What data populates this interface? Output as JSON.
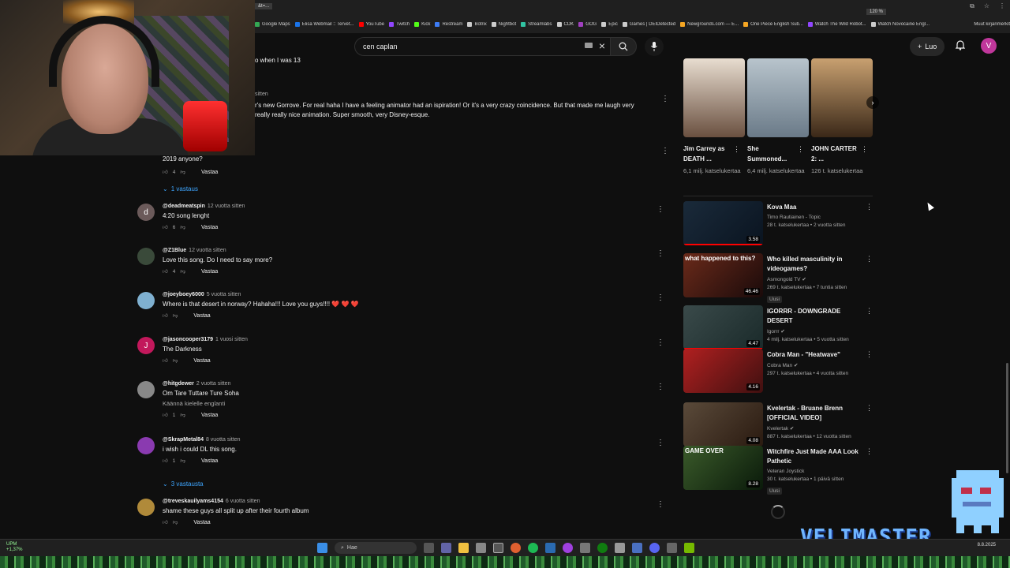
{
  "browser": {
    "url_fragment": "&t=...",
    "zoom": "120 %",
    "bookmarks": [
      {
        "label": "Google Maps",
        "color": "#34a853"
      },
      {
        "label": "Elisa Webmail :: Tervet...",
        "color": "#1a73e8"
      },
      {
        "label": "YouTube",
        "color": "#ff0000"
      },
      {
        "label": "Twitch",
        "color": "#9146ff"
      },
      {
        "label": "Kick",
        "color": "#53fc18"
      },
      {
        "label": "Restream",
        "color": "#3d7cf5"
      },
      {
        "label": "Botrix",
        "color": "#cccccc"
      },
      {
        "label": "Nightbot",
        "color": "#cccccc"
      },
      {
        "label": "Streamlabs",
        "color": "#31c3a2"
      },
      {
        "label": "CDK",
        "color": "#cccccc"
      },
      {
        "label": "GOG",
        "color": "#a040c0"
      },
      {
        "label": "Epic",
        "color": "#cccccc"
      },
      {
        "label": "Games | DEIDetected",
        "color": "#cccccc"
      },
      {
        "label": "Newgrounds.com — E...",
        "color": "#f5a623"
      },
      {
        "label": "One Piece English Sub...",
        "color": "#f5a623"
      },
      {
        "label": "Watch The Wild Robot...",
        "color": "#9146ff"
      },
      {
        "label": "Watch Novocaine Engl...",
        "color": "#cccccc"
      }
    ],
    "other_bookmarks": "Muut kirjanmerkit"
  },
  "yt_header": {
    "search_value": "cen caplan",
    "create_label": "Luo",
    "user_initial": "V"
  },
  "comments": {
    "partial_top": "o when I was 13",
    "partial_time": "sitten",
    "partial_text_line1": "r's new Gorrove. For real haha I have a feeling animator had an ispiration! Or it's a very crazy coincidence. But that made me laugh very",
    "partial_text_line2": "really really nice animation. Super smooth, very Disney-esque.",
    "partial_comment2_text": "2019 anyone?",
    "partial_comment2_likes": "4",
    "reply_label": "Vastaa",
    "one_reply": "1 vastaus",
    "items": [
      {
        "author": "@deadmeatspin",
        "time": "12 vuotta sitten",
        "text": "4:20 song lenght",
        "likes": "6",
        "avatar_letter": "d",
        "avatar_color": "#6b5a5a"
      },
      {
        "author": "@Z1Blue",
        "time": "12 vuotta sitten",
        "text": "Love this song. Do I need to say more?",
        "likes": "4",
        "avatar_letter": "",
        "avatar_color": "#3a4a3a"
      },
      {
        "author": "@joeyboey6000",
        "time": "5 vuotta sitten",
        "text": "Where is that desert in norway? Hahaha!!! Love you guys!!!! ❤️ ❤️ ❤️",
        "likes": "",
        "avatar_letter": "",
        "avatar_color": "#7fb0d0"
      },
      {
        "author": "@jasoncooper3179",
        "time": "1 vuosi sitten",
        "text": "The Darkness",
        "likes": "",
        "avatar_letter": "J",
        "avatar_color": "#c2185b"
      },
      {
        "author": "@hitgdewer",
        "time": "2 vuotta sitten",
        "text": "Om Tare Tuttare Ture Soha",
        "translate": "Käännä kielelle englanti",
        "likes": "1",
        "avatar_letter": "",
        "avatar_color": "#888888"
      },
      {
        "author": "@SkrapMetal84",
        "time": "8 vuotta sitten",
        "text": "i wish i could DL this song.",
        "likes": "1",
        "avatar_letter": "",
        "avatar_color": "#8a3ab0"
      },
      {
        "author": "@treveskauilyams4154",
        "time": "6 vuotta sitten",
        "text": "shame these guys all split up after their fourth album",
        "likes": "",
        "avatar_letter": "",
        "avatar_color": "#b08a3a"
      }
    ],
    "three_replies": "3 vastausta"
  },
  "shorts": [
    {
      "title": "Jim Carrey as DEATH ...",
      "views": "6,1 milj. katselukertaa",
      "color1": "#e8ddd0",
      "color2": "#6a5040"
    },
    {
      "title": "She Summoned...",
      "views": "6,4 milj. katselukertaa",
      "color1": "#b8c4cc",
      "color2": "#6a7a88"
    },
    {
      "title": "JOHN CARTER 2: ...",
      "views": "126 t. katselukertaa",
      "color1": "#c8a070",
      "color2": "#3a2818"
    }
  ],
  "videos": [
    {
      "title": "Kova Maa",
      "channel": "Timo Rautiainen - Topic",
      "meta": "28 t. katselukertaa • 2 vuotta sitten",
      "duration": "3.58",
      "progress": 100,
      "new": "",
      "thumb1": "#1a2a3a",
      "thumb2": "#0a1420",
      "verified": false
    },
    {
      "title": "Who killed masculinity in videogames?",
      "channel": "Asmongold TV",
      "meta": "269 t. katselukertaa • 7 tuntia sitten",
      "duration": "46.46",
      "progress": 0,
      "new": "Uusi",
      "thumb1": "#6a2a1a",
      "thumb2": "#1a0a0a",
      "thumb_text": "what happened to this?",
      "verified": true
    },
    {
      "title": "IGORRR - DOWNGRADE DESERT",
      "channel": "Igorrr",
      "meta": "4 milj. katselukertaa • 5 vuotta sitten",
      "duration": "4.47",
      "progress": 100,
      "new": "",
      "thumb1": "#3a4a4a",
      "thumb2": "#1a2a2a",
      "verified": true
    },
    {
      "title": "Cobra Man - \"Heatwave\"",
      "channel": "Cobra Man",
      "meta": "297 t. katselukertaa • 4 vuotta sitten",
      "duration": "4.16",
      "progress": 0,
      "new": "",
      "thumb1": "#b02020",
      "thumb2": "#401010",
      "verified": true
    },
    {
      "title": "Kvelertak - Bruane Brenn [OFFICIAL VIDEO]",
      "channel": "Kvelertak",
      "meta": "887 t. katselukertaa • 12 vuotta sitten",
      "duration": "4.08",
      "progress": 0,
      "new": "",
      "thumb1": "#5a4a3a",
      "thumb2": "#2a1a10",
      "verified": true
    },
    {
      "title": "Witchfire Just Made AAA Look Pathetic",
      "channel": "Veteran Joystick",
      "meta": "30 t. katselukertaa • 1 päivä sitten",
      "duration": "8.28",
      "progress": 0,
      "new": "Uusi",
      "thumb1": "#3a5a2a",
      "thumb2": "#0a1a0a",
      "thumb_text": "GAME OVER",
      "verified": false
    }
  ],
  "overlay": {
    "brand": "VELIMASTER"
  },
  "taskbar": {
    "ticker": "UPM",
    "ticker_change": "+1,37%",
    "search_placeholder": "Hae",
    "date": "8.8.2025"
  }
}
